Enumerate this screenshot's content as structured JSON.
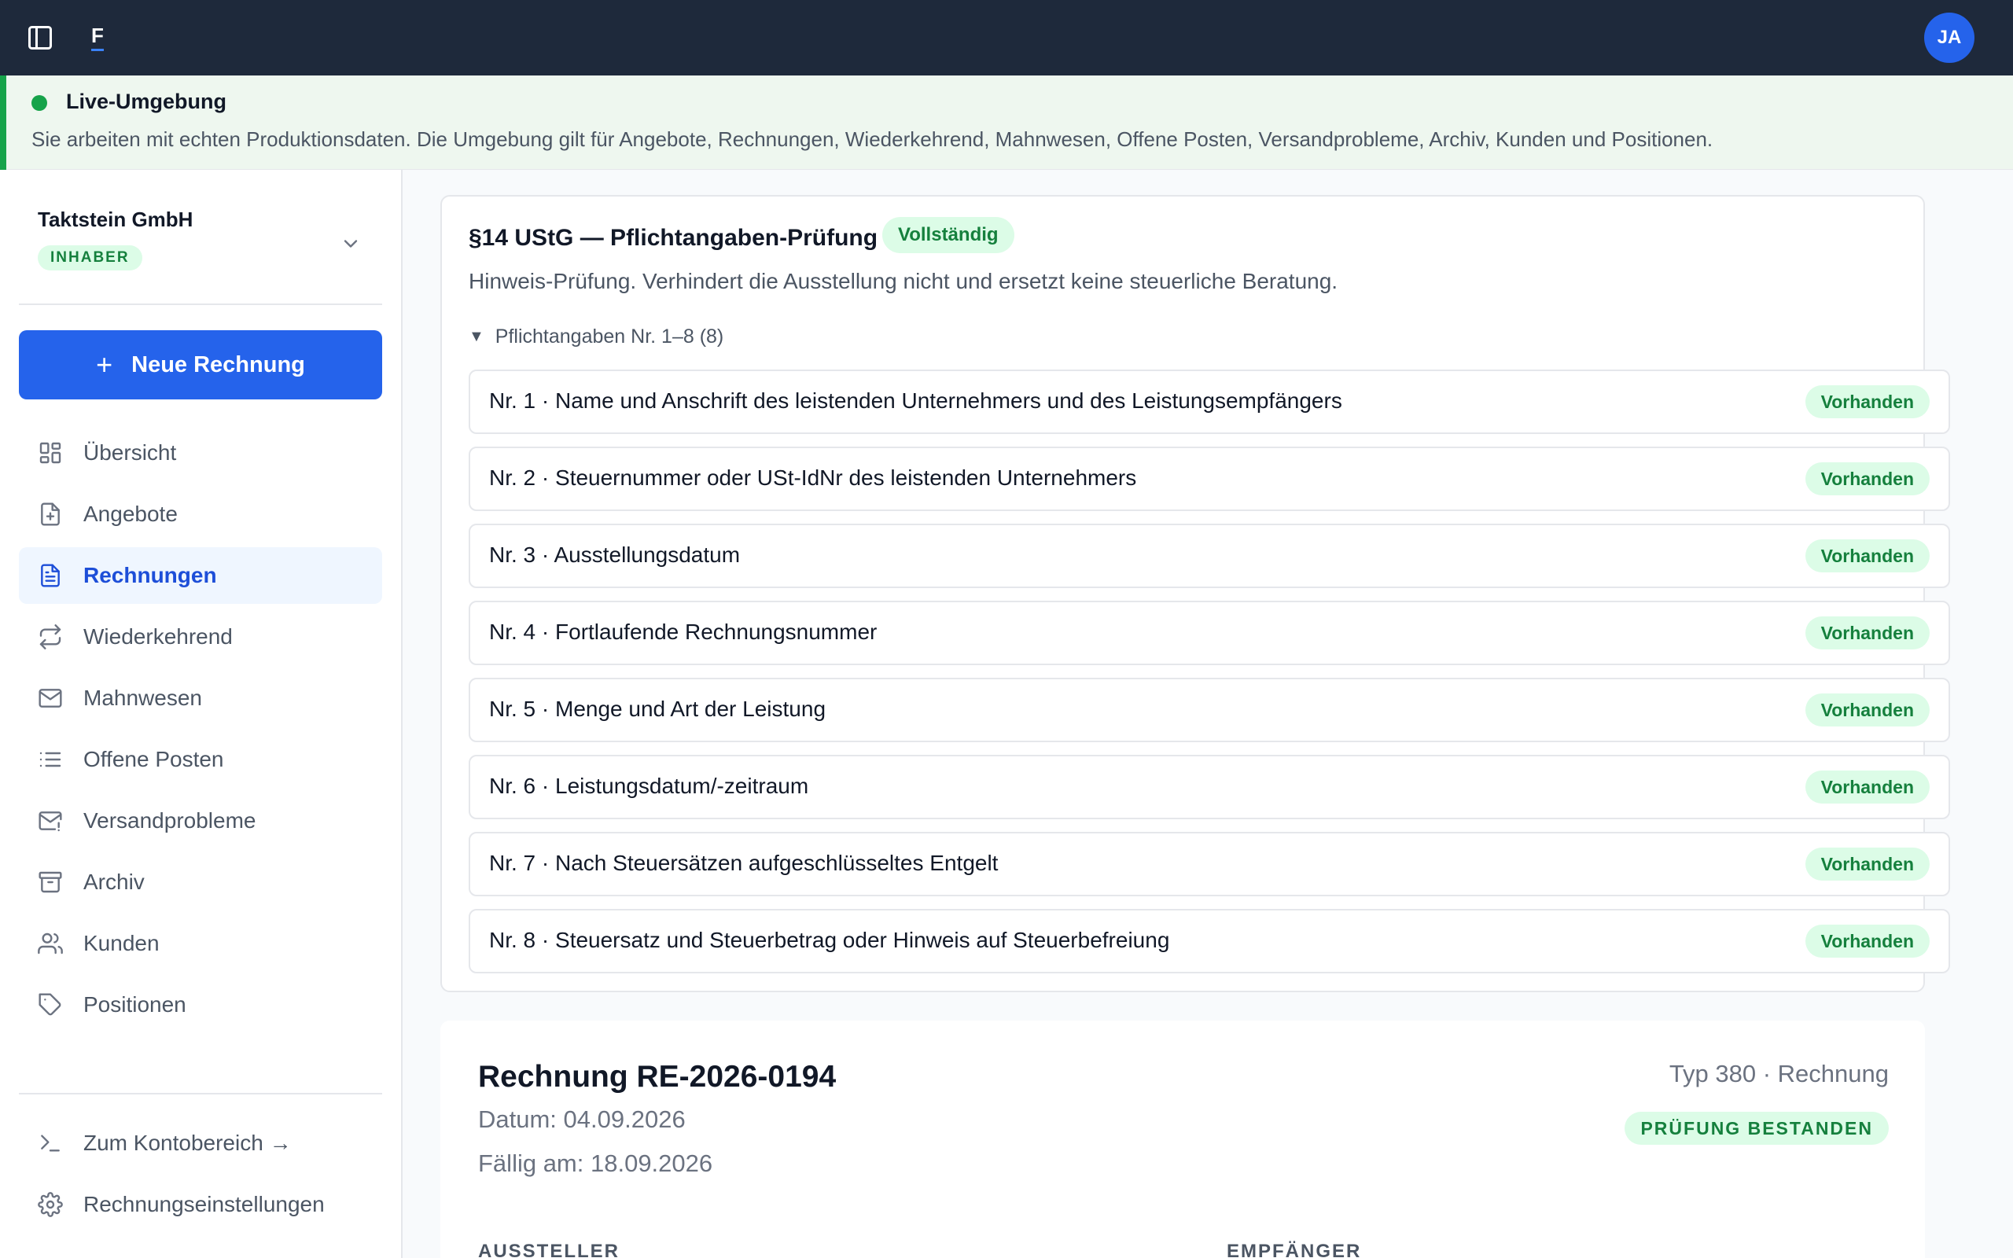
{
  "topbar": {
    "logo": "F",
    "avatar_initials": "JA"
  },
  "environment": {
    "title": "Live-Umgebung",
    "description": "Sie arbeiten mit echten Produktionsdaten. Die Umgebung gilt für Angebote, Rechnungen, Wiederkehrend, Mahnwesen, Offene Posten, Versandprobleme, Archiv, Kunden und Positionen.",
    "status_color": "#16a34a"
  },
  "sidebar": {
    "org_name": "Taktstein GmbH",
    "role": "INHABER",
    "new_invoice_label": "Neue Rechnung",
    "items": [
      {
        "label": "Übersicht",
        "icon": "dashboard-icon"
      },
      {
        "label": "Angebote",
        "icon": "file-plus-icon"
      },
      {
        "label": "Rechnungen",
        "icon": "file-text-icon",
        "active": true
      },
      {
        "label": "Wiederkehrend",
        "icon": "repeat-icon"
      },
      {
        "label": "Mahnwesen",
        "icon": "mail-icon"
      },
      {
        "label": "Offene Posten",
        "icon": "list-icon"
      },
      {
        "label": "Versandprobleme",
        "icon": "mail-alert-icon"
      },
      {
        "label": "Archiv",
        "icon": "archive-icon"
      },
      {
        "label": "Kunden",
        "icon": "users-icon"
      },
      {
        "label": "Positionen",
        "icon": "tag-icon"
      }
    ],
    "footer": [
      {
        "label": "Zum Kontobereich →",
        "icon": "terminal-icon"
      },
      {
        "label": "Rechnungseinstellungen",
        "icon": "gear-icon"
      }
    ]
  },
  "check": {
    "title": "§14 UStG — Pflichtangaben-Prüfung",
    "badge": "Vollständig",
    "hint": "Hinweis-Prüfung. Verhindert die Ausstellung nicht und ersetzt keine steuerliche Beratung.",
    "summary": "Pflichtangaben Nr. 1–8 (8)",
    "items": [
      {
        "text": "Nr. 1 · Name und Anschrift des leistenden Unternehmers und des Leistungsempfängers",
        "status": "Vorhanden"
      },
      {
        "text": "Nr. 2 · Steuernummer oder USt-IdNr des leistenden Unternehmers",
        "status": "Vorhanden"
      },
      {
        "text": "Nr. 3 · Ausstellungsdatum",
        "status": "Vorhanden"
      },
      {
        "text": "Nr. 4 · Fortlaufende Rechnungsnummer",
        "status": "Vorhanden"
      },
      {
        "text": "Nr. 5 · Menge und Art der Leistung",
        "status": "Vorhanden"
      },
      {
        "text": "Nr. 6 · Leistungsdatum/-zeitraum",
        "status": "Vorhanden"
      },
      {
        "text": "Nr. 7 · Nach Steuersätzen aufgeschlüsseltes Entgelt",
        "status": "Vorhanden"
      },
      {
        "text": "Nr. 8 · Steuersatz und Steuerbetrag oder Hinweis auf Steuerbefreiung",
        "status": "Vorhanden"
      }
    ]
  },
  "invoice": {
    "title": "Rechnung RE-2026-0194",
    "date": "Datum: 04.09.2026",
    "due": "Fällig am: 18.09.2026",
    "type": "Typ 380 · Rechnung",
    "status": "PRÜFUNG BESTANDEN",
    "issuer_label": "AUSSTELLER",
    "recipient_label": "EMPFÄNGER"
  }
}
